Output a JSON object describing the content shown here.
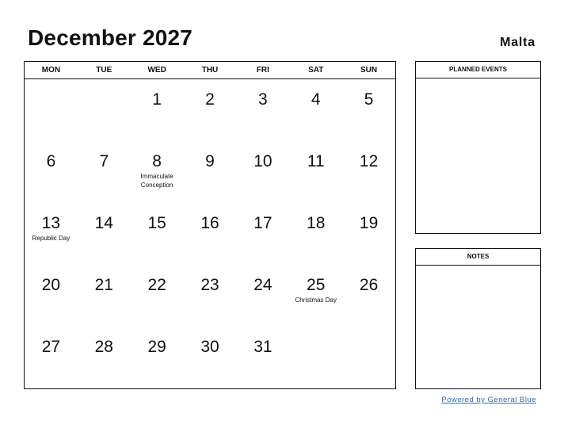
{
  "header": {
    "title": "December 2027",
    "country": "Malta"
  },
  "calendar": {
    "weekdays": [
      "MON",
      "TUE",
      "WED",
      "THU",
      "FRI",
      "SAT",
      "SUN"
    ],
    "weeks": [
      [
        {
          "day": "",
          "holiday": ""
        },
        {
          "day": "",
          "holiday": ""
        },
        {
          "day": "1",
          "holiday": ""
        },
        {
          "day": "2",
          "holiday": ""
        },
        {
          "day": "3",
          "holiday": ""
        },
        {
          "day": "4",
          "holiday": ""
        },
        {
          "day": "5",
          "holiday": ""
        }
      ],
      [
        {
          "day": "6",
          "holiday": ""
        },
        {
          "day": "7",
          "holiday": ""
        },
        {
          "day": "8",
          "holiday": "Immaculate Conception"
        },
        {
          "day": "9",
          "holiday": ""
        },
        {
          "day": "10",
          "holiday": ""
        },
        {
          "day": "11",
          "holiday": ""
        },
        {
          "day": "12",
          "holiday": ""
        }
      ],
      [
        {
          "day": "13",
          "holiday": "Republic Day"
        },
        {
          "day": "14",
          "holiday": ""
        },
        {
          "day": "15",
          "holiday": ""
        },
        {
          "day": "16",
          "holiday": ""
        },
        {
          "day": "17",
          "holiday": ""
        },
        {
          "day": "18",
          "holiday": ""
        },
        {
          "day": "19",
          "holiday": ""
        }
      ],
      [
        {
          "day": "20",
          "holiday": ""
        },
        {
          "day": "21",
          "holiday": ""
        },
        {
          "day": "22",
          "holiday": ""
        },
        {
          "day": "23",
          "holiday": ""
        },
        {
          "day": "24",
          "holiday": ""
        },
        {
          "day": "25",
          "holiday": "Christmas Day"
        },
        {
          "day": "26",
          "holiday": ""
        }
      ],
      [
        {
          "day": "27",
          "holiday": ""
        },
        {
          "day": "28",
          "holiday": ""
        },
        {
          "day": "29",
          "holiday": ""
        },
        {
          "day": "30",
          "holiday": ""
        },
        {
          "day": "31",
          "holiday": ""
        },
        {
          "day": "",
          "holiday": ""
        },
        {
          "day": "",
          "holiday": ""
        }
      ]
    ]
  },
  "panels": {
    "events_title": "PLANNED EVENTS",
    "notes_title": "NOTES"
  },
  "footer": {
    "powered_by": "Powered by General Blue"
  },
  "colors": {
    "link": "#2a6db5",
    "border": "#111111"
  }
}
